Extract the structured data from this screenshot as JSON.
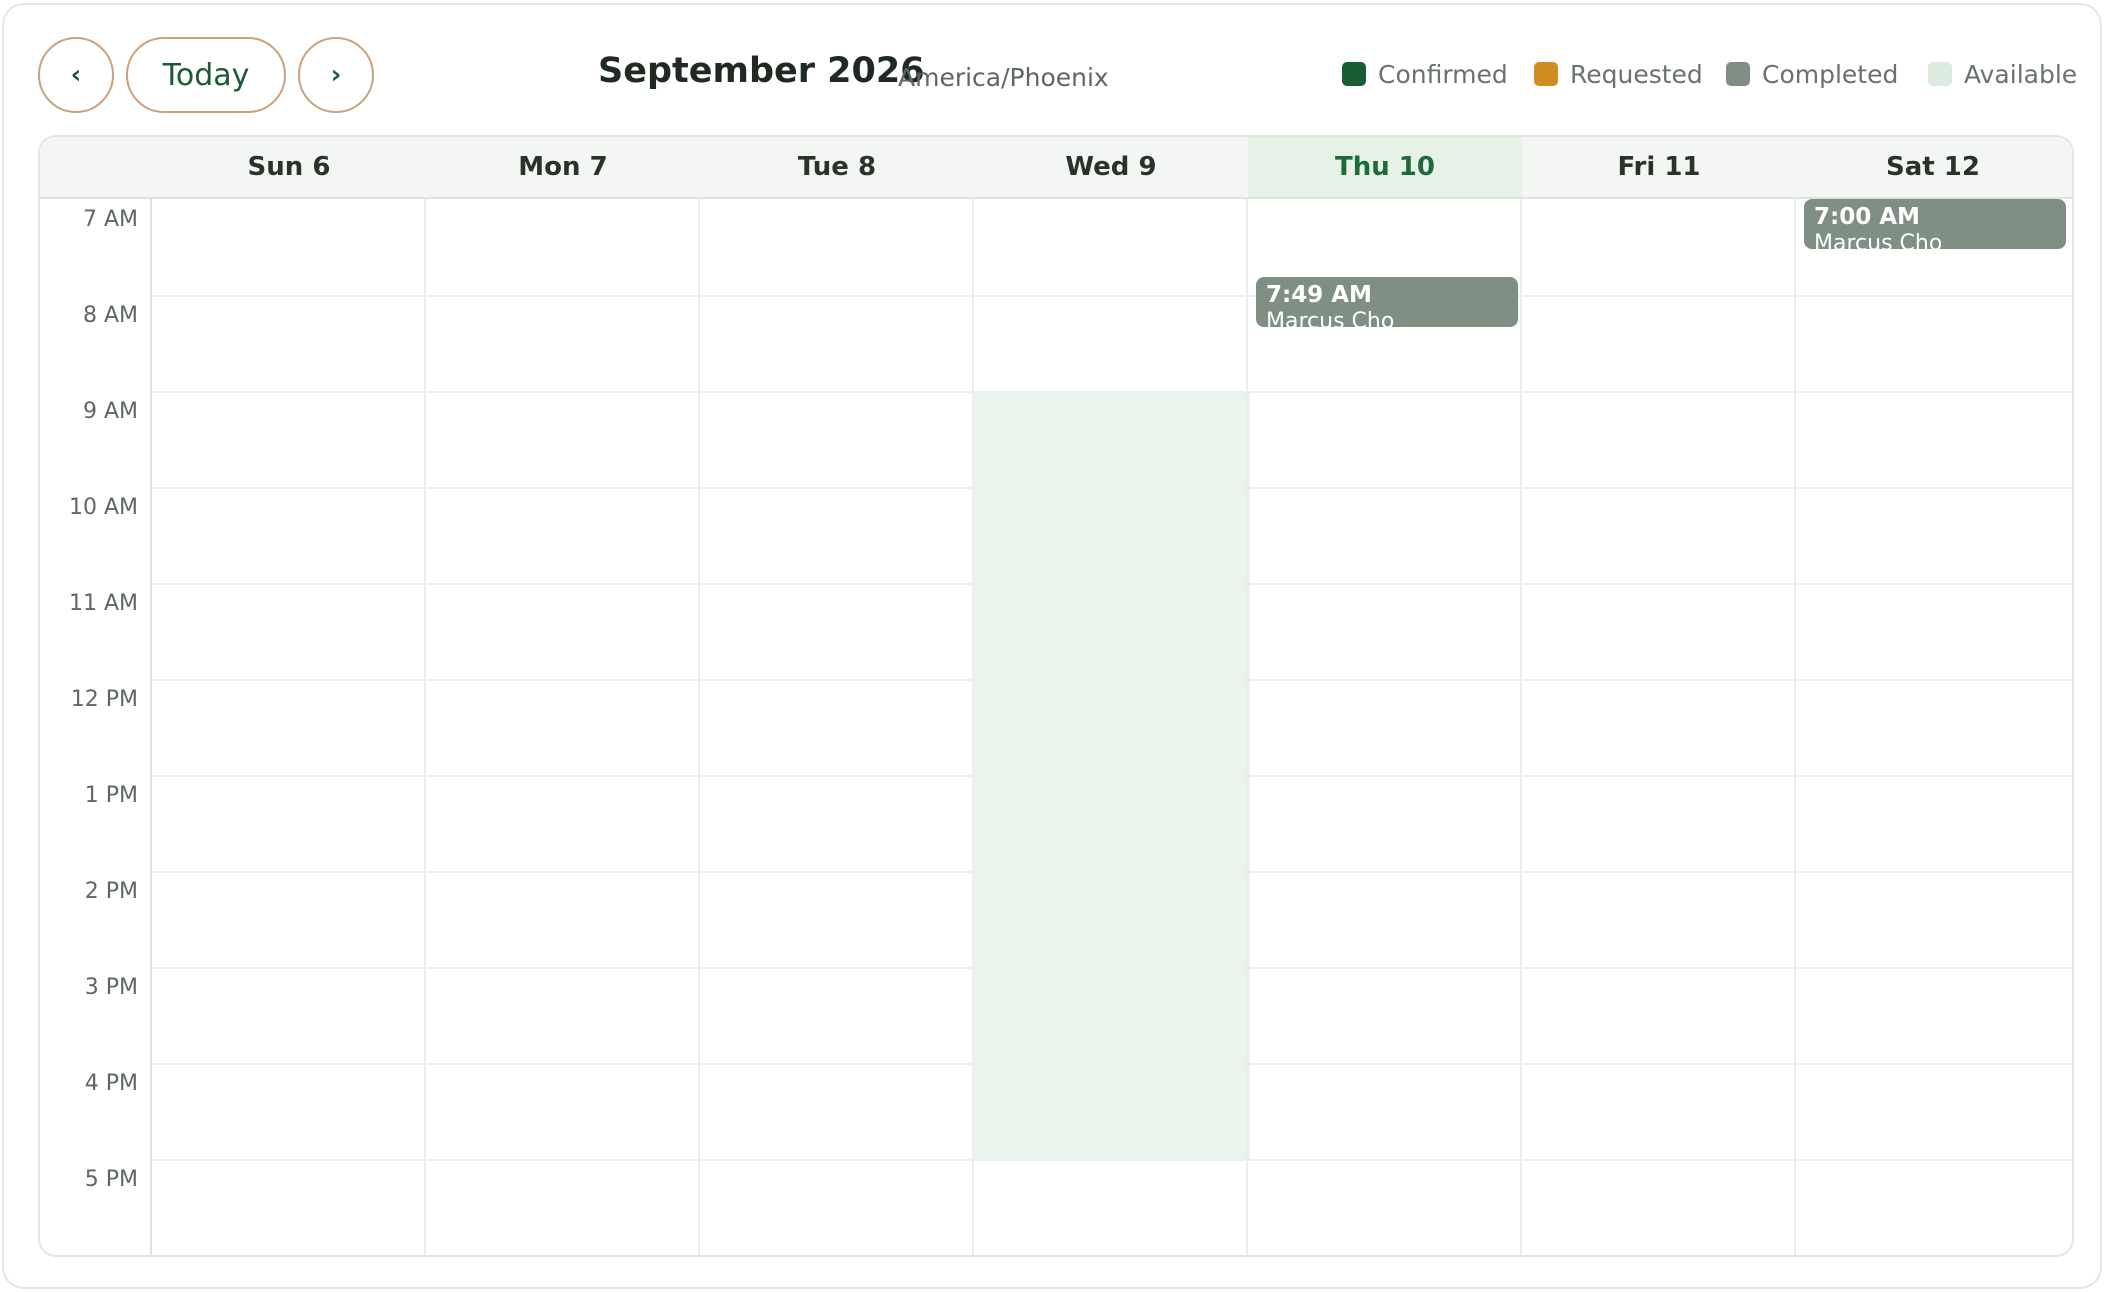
{
  "toolbar": {
    "prev_label": "‹",
    "today_label": "Today",
    "next_label": "›",
    "title": "September 2026",
    "timezone": "America/Phoenix"
  },
  "legend": [
    {
      "label": "Confirmed",
      "color": "#1a5c34"
    },
    {
      "label": "Requested",
      "color": "#d08d1f"
    },
    {
      "label": "Completed",
      "color": "#7f8f84"
    },
    {
      "label": "Available",
      "color": "#dcebdf"
    }
  ],
  "days": [
    {
      "label": "Sun 6",
      "today": false
    },
    {
      "label": "Mon 7",
      "today": false
    },
    {
      "label": "Tue 8",
      "today": false
    },
    {
      "label": "Wed 9",
      "today": false
    },
    {
      "label": "Thu 10",
      "today": true
    },
    {
      "label": "Fri 11",
      "today": false
    },
    {
      "label": "Sat 12",
      "today": false
    }
  ],
  "hours": [
    "7 AM",
    "8 AM",
    "9 AM",
    "10 AM",
    "11 AM",
    "12 PM",
    "1 PM",
    "2 PM",
    "3 PM",
    "4 PM",
    "5 PM"
  ],
  "availability": [
    {
      "day": "Wed 9",
      "start": "9 AM",
      "end": "5 PM"
    }
  ],
  "events": [
    {
      "day": "Thu 10",
      "time": "7:49 AM",
      "name": "Marcus Cho",
      "status": "Completed"
    },
    {
      "day": "Sat 12",
      "time": "7:00 AM",
      "name": "Marcus Cho",
      "status": "Completed"
    }
  ]
}
